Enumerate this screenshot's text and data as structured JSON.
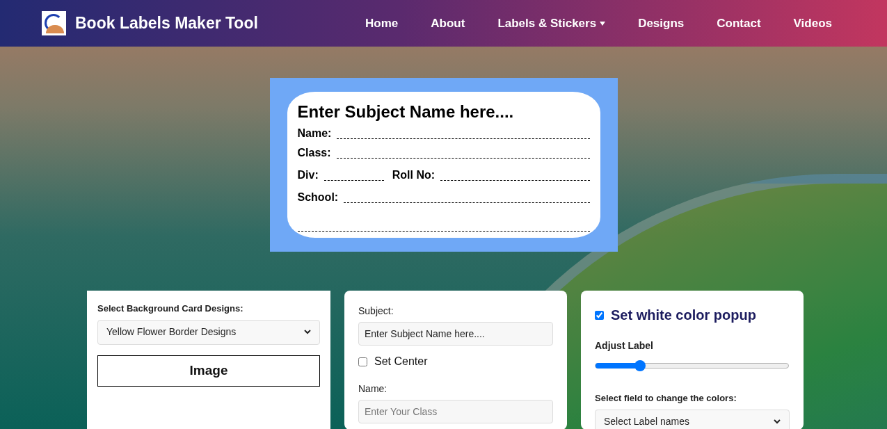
{
  "header": {
    "title": "Book Labels Maker Tool",
    "nav": [
      {
        "label": "Home",
        "dropdown": false
      },
      {
        "label": "About",
        "dropdown": false
      },
      {
        "label": "Labels & Stickers",
        "dropdown": true
      },
      {
        "label": "Designs",
        "dropdown": false
      },
      {
        "label": "Contact",
        "dropdown": false
      },
      {
        "label": "Videos",
        "dropdown": false
      }
    ]
  },
  "label_preview": {
    "title": "Enter Subject Name here....",
    "rows": [
      [
        {
          "label": "Name:"
        }
      ],
      [
        {
          "label": "Class:"
        }
      ],
      [
        {
          "label": "Div:"
        },
        {
          "label": "Roll No:"
        }
      ],
      [
        {
          "label": "School:"
        }
      ]
    ],
    "blank_line": true
  },
  "design_panel": {
    "label": "Select Background Card Designs:",
    "select_value": "Yellow Flower Border Designs",
    "image_button": "Image"
  },
  "text_panel": {
    "subject_label": "Subject:",
    "subject_value": "Enter Subject Name here....",
    "center": {
      "label": "Set Center",
      "checked": false
    },
    "name_label": "Name:",
    "name_placeholder": "Enter Your Class"
  },
  "style_panel": {
    "popup": {
      "label": "Set white color popup",
      "checked": true
    },
    "adjust_label": "Adjust Label",
    "level": 0.23,
    "colors_label": "Select field to change the colors:",
    "colors_select": "Select Label names"
  }
}
